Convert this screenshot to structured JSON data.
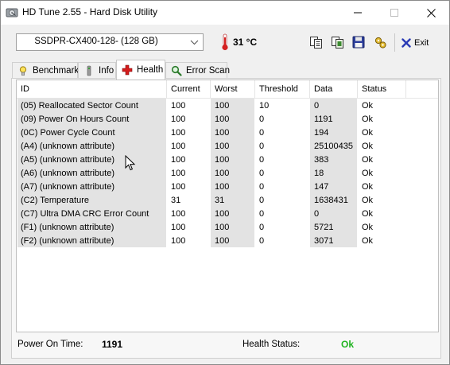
{
  "window": {
    "title": "HD Tune 2.55 - Hard Disk Utility"
  },
  "toolbar": {
    "drive": "SSDPR-CX400-128- (128 GB)",
    "temperature": "31 °C",
    "exit_label": "Exit",
    "icons": [
      "copy-icon",
      "copy-screenshot-icon",
      "save-icon",
      "options-icon",
      "exit-icon"
    ]
  },
  "tabs": [
    {
      "label": "Benchmark",
      "icon": "lightbulb-icon"
    },
    {
      "label": "Info",
      "icon": "info-icon"
    },
    {
      "label": "Health",
      "icon": "health-cross-icon",
      "active": true
    },
    {
      "label": "Error Scan",
      "icon": "magnifier-icon"
    }
  ],
  "columns": [
    "ID",
    "Current",
    "Worst",
    "Threshold",
    "Data",
    "Status"
  ],
  "rows": [
    [
      "(05) Reallocated Sector Count",
      "100",
      "100",
      "10",
      "0",
      "Ok"
    ],
    [
      "(09) Power On Hours Count",
      "100",
      "100",
      "0",
      "1191",
      "Ok"
    ],
    [
      "(0C) Power Cycle Count",
      "100",
      "100",
      "0",
      "194",
      "Ok"
    ],
    [
      "(A4) (unknown attribute)",
      "100",
      "100",
      "0",
      "25100435",
      "Ok"
    ],
    [
      "(A5) (unknown attribute)",
      "100",
      "100",
      "0",
      "383",
      "Ok"
    ],
    [
      "(A6) (unknown attribute)",
      "100",
      "100",
      "0",
      "18",
      "Ok"
    ],
    [
      "(A7) (unknown attribute)",
      "100",
      "100",
      "0",
      "147",
      "Ok"
    ],
    [
      "(C2) Temperature",
      "31",
      "31",
      "0",
      "1638431",
      "Ok"
    ],
    [
      "(C7) Ultra DMA CRC Error Count",
      "100",
      "100",
      "0",
      "0",
      "Ok"
    ],
    [
      "(F1) (unknown attribute)",
      "100",
      "100",
      "0",
      "5721",
      "Ok"
    ],
    [
      "(F2) (unknown attribute)",
      "100",
      "100",
      "0",
      "3071",
      "Ok"
    ]
  ],
  "footer": {
    "power_on_label": "Power On Time:",
    "power_on_value": "1191",
    "health_label": "Health Status:",
    "health_value": "Ok"
  },
  "colors": {
    "health_ok": "#22b422",
    "health_tab_cross": "#d41c1c",
    "thermometer": "#d42020",
    "exit_x": "#2a3bb5",
    "column_shade": "#e3e3e3"
  }
}
